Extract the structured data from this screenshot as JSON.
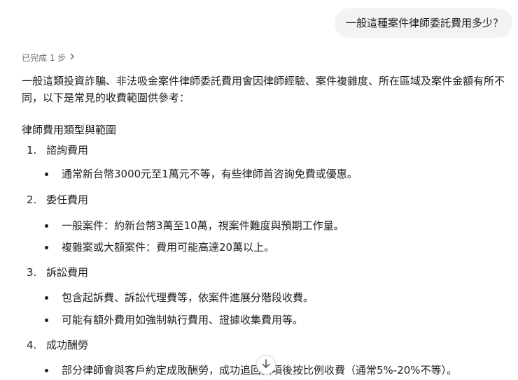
{
  "user_message": "一般這種案件律師委託費用多少？",
  "steps_label": "已完成 1 步",
  "intro": "一般這類投資詐騙、非法吸金案件律師委託費用會因律師經驗、案件複雜度、所在區域及案件金額有所不同，以下是常見的收費範圍供參考：",
  "section_title": "律師費用類型與範圍",
  "items": [
    {
      "num": "1.",
      "title": "諮詢費用",
      "bullets": [
        "通常新台幣3000元至1萬元不等，有些律師首咨詢免費或優惠。"
      ]
    },
    {
      "num": "2.",
      "title": "委任費用",
      "bullets": [
        "一般案件：約新台幣3萬至10萬，視案件難度與預期工作量。",
        "複雜案或大額案件：費用可能高達20萬以上。"
      ]
    },
    {
      "num": "3.",
      "title": "訴訟費用",
      "bullets": [
        "包含起訴費、訴訟代理費等，依案件進展分階段收費。",
        "可能有額外費用如強制執行費用、證據收集費用等。"
      ]
    },
    {
      "num": "4.",
      "title": "成功酬勞",
      "bullets": [
        "部分律師會與客戶約定成敗酬勞，成功追回款項後按比例收費（通常5%-20%不等）。"
      ]
    }
  ],
  "icons": {
    "steps_chevron": "chevron-right-icon",
    "scroll": "arrow-down-icon"
  }
}
